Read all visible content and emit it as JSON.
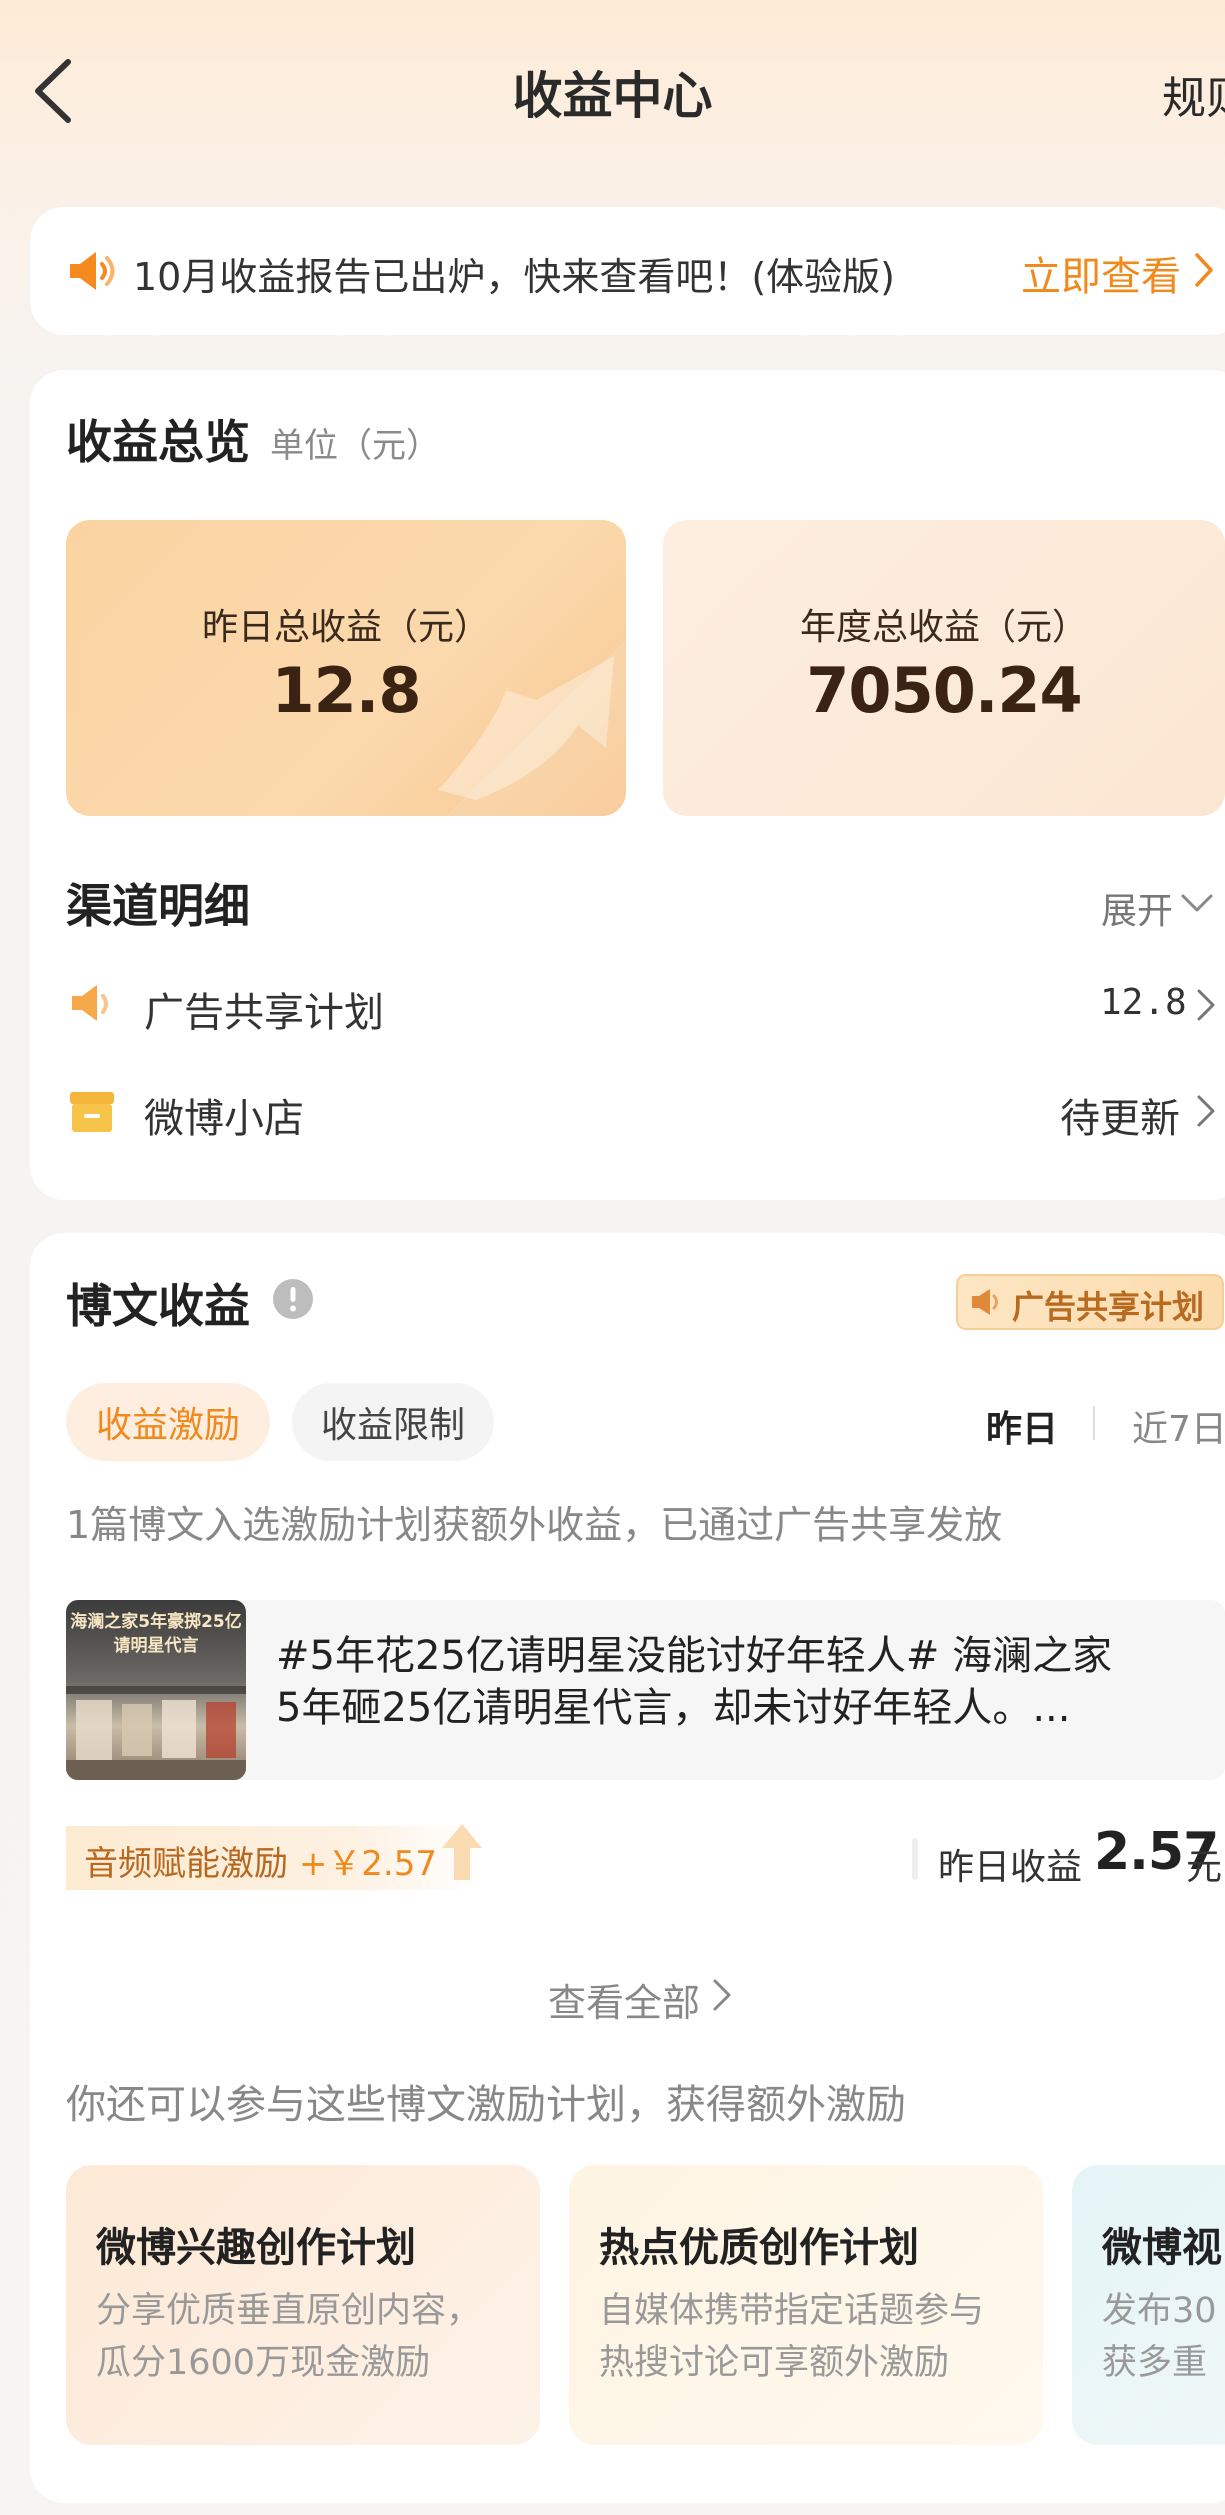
{
  "header": {
    "title": "收益中心",
    "rules_label": "规则"
  },
  "notice": {
    "text": "10月收益报告已出炉，快来查看吧！(体验版)",
    "link": "立即查看"
  },
  "overview": {
    "title": "收益总览",
    "unit": "单位（元）",
    "yesterday": {
      "label": "昨日总收益（元）",
      "value": "12.8"
    },
    "annual": {
      "label": "年度总收益（元）",
      "value": "7050.24"
    }
  },
  "channels": {
    "title": "渠道明细",
    "expand_label": "展开",
    "items": [
      {
        "label": "广告共享计划",
        "value": "12.8",
        "icon": "megaphone-icon"
      },
      {
        "label": "微博小店",
        "value": "待更新",
        "icon": "shop-icon"
      }
    ]
  },
  "blog": {
    "title": "博文收益",
    "badge": "广告共享计划",
    "tabs": [
      "收益激励",
      "收益限制"
    ],
    "periods": [
      "昨日",
      "近7日"
    ],
    "description": "1篇博文入选激励计划获额外收益，已通过广告共享发放",
    "post": {
      "thumb_title": "海澜之家5年豪掷25亿请明星代言",
      "line1": "#5年花25亿请明星没能讨好年轻人# 海澜之家",
      "line2": "5年砸25亿请明星代言，却未讨好年轻人。..."
    },
    "audio_badge": {
      "label": "音频赋能激励",
      "amount": "+￥2.57"
    },
    "yesterday": {
      "label": "昨日收益",
      "value": "2.57",
      "unit": "元"
    },
    "view_all": "查看全部"
  },
  "more": {
    "description": "你还可以参与这些博文激励计划，获得额外激励",
    "plans": [
      {
        "title": "微博兴趣创作计划",
        "desc1": "分享优质垂直原创内容，",
        "desc2": "瓜分1600万现金激励"
      },
      {
        "title": "热点优质创作计划",
        "desc1": "自媒体携带指定话题参与",
        "desc2": "热搜讨论可享额外激励"
      },
      {
        "title": "微博视",
        "desc1": "发布30",
        "desc2": "获多重"
      }
    ]
  },
  "colors": {
    "accent": "#f08a1c",
    "value_dark": "#3b2314"
  }
}
